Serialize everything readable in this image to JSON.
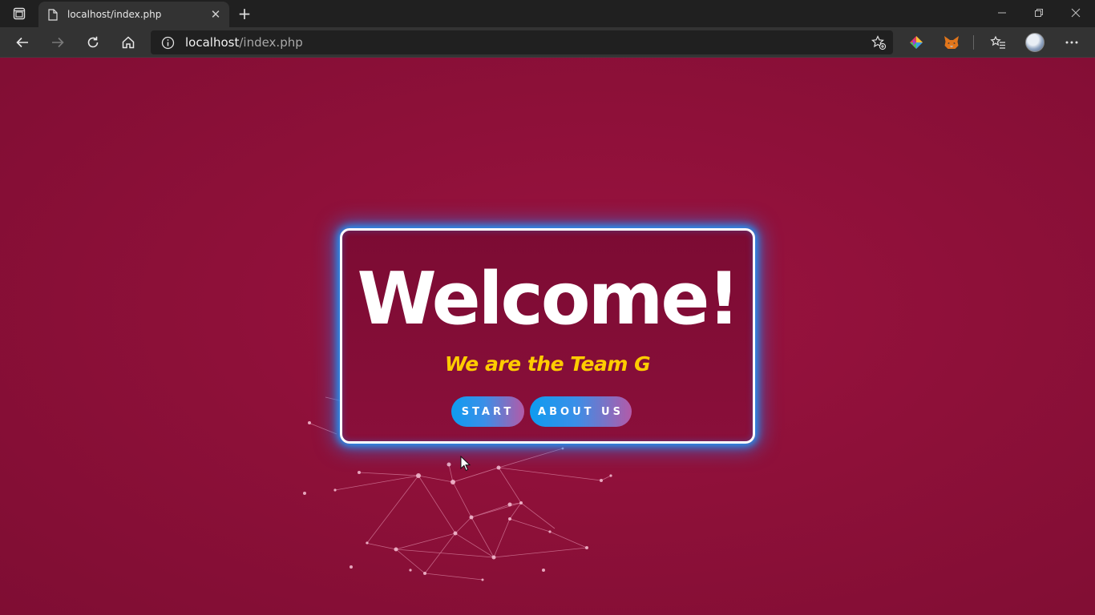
{
  "browser": {
    "tab": {
      "title": "localhost/index.php",
      "close": "✕"
    },
    "new_tab": "+",
    "address": {
      "host": "localhost",
      "path": "/index.php"
    }
  },
  "page": {
    "heading": "Welcome!",
    "tagline": "We are the Team G",
    "buttons": {
      "start": "START",
      "about": "ABOUT US"
    },
    "colors": {
      "background": "#8e1039",
      "card_border": "#ffffff",
      "card_glow": "#1e9bff",
      "tagline": "#ffcc00",
      "button_left": "#0e9cf0",
      "button_right": "#b35aa8"
    }
  }
}
